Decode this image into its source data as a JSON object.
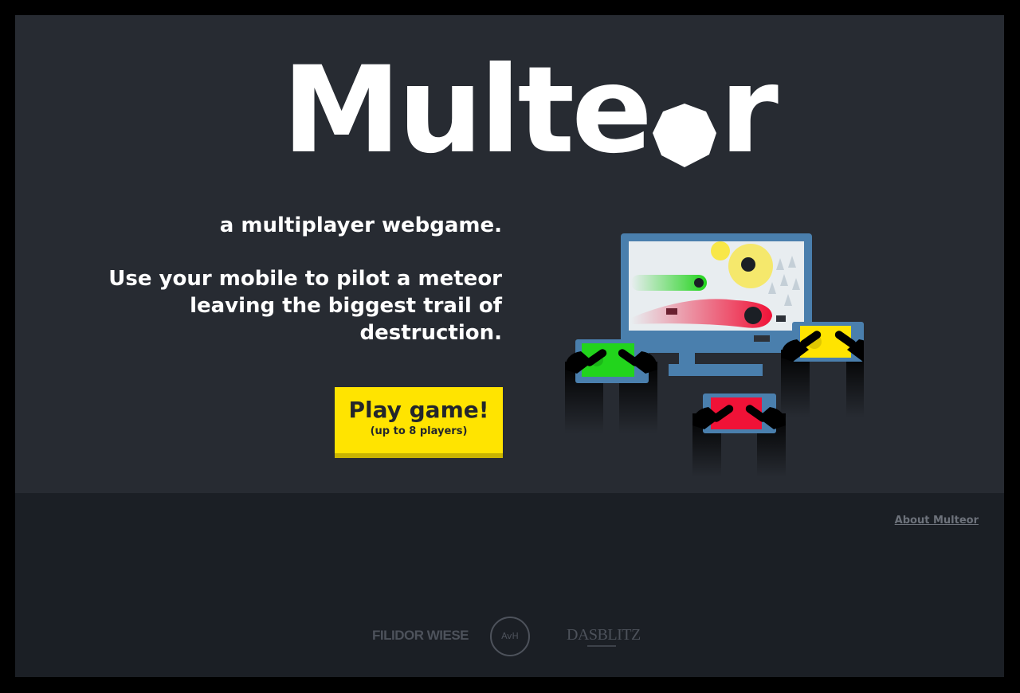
{
  "hero": {
    "logo_text_main": "Multe",
    "logo_text_end": "r",
    "tagline": "a multiplayer webgame.",
    "description": "Use your mobile to pilot a meteor leaving the biggest trail of destruction.",
    "play_button": {
      "title": "Play game!",
      "subtitle": "(up to 8 players)"
    }
  },
  "footer": {
    "about_link": "About Multeor",
    "sponsors": {
      "filidor": "FILIDOR WIESE",
      "avh": "AvH",
      "dasblitz": "DASBLITZ"
    }
  },
  "colors": {
    "background": "#272b32",
    "footer_bg": "#1b1f25",
    "button": "#ffe400",
    "monitor": "#4a7fad",
    "phone_green": "#22d41c",
    "phone_red": "#f01237",
    "phone_yellow": "#ffe400"
  },
  "icons": [
    "meteor-logo-icon",
    "monitor-illustration",
    "phone-green-icon",
    "phone-red-icon",
    "phone-yellow-icon"
  ]
}
